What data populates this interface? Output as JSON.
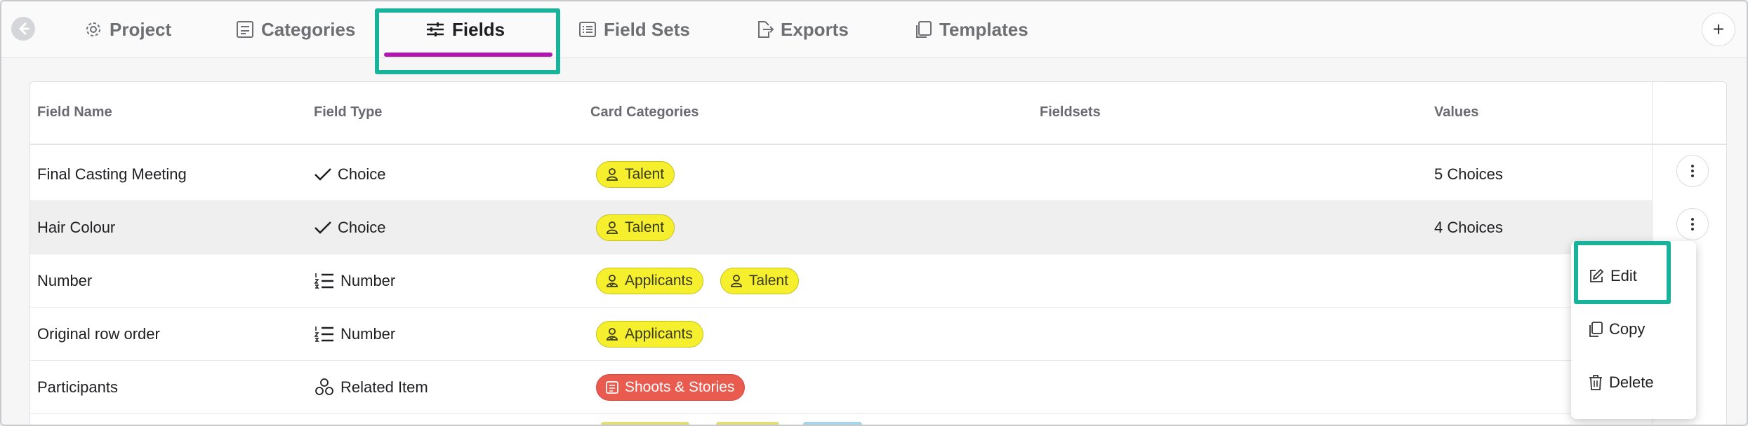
{
  "tabs": [
    {
      "label": "Project",
      "icon": "gear-icon"
    },
    {
      "label": "Categories",
      "icon": "categories-icon"
    },
    {
      "label": "Fields",
      "icon": "sliders-icon",
      "active": true
    },
    {
      "label": "Field Sets",
      "icon": "list-icon"
    },
    {
      "label": "Exports",
      "icon": "export-icon"
    },
    {
      "label": "Templates",
      "icon": "copy-icon"
    }
  ],
  "add_label": "+",
  "table": {
    "headers": [
      "Field Name",
      "Field Type",
      "Card Categories",
      "Fieldsets",
      "Values"
    ],
    "rows": [
      {
        "name": "Final Casting Meeting",
        "type": "Choice",
        "type_icon": "check-icon",
        "categories": [
          "Talent"
        ],
        "values": "5 Choices"
      },
      {
        "name": "Hair Colour",
        "type": "Choice",
        "type_icon": "check-icon",
        "categories": [
          "Talent"
        ],
        "values": "4 Choices",
        "hover": true
      },
      {
        "name": "Number",
        "type": "Number",
        "type_icon": "numbered-list-icon",
        "categories": [
          "Applicants",
          "Talent"
        ],
        "values": ""
      },
      {
        "name": "Original row order",
        "type": "Number",
        "type_icon": "numbered-list-icon",
        "categories": [
          "Applicants"
        ],
        "values": ""
      },
      {
        "name": "Participants",
        "type": "Related Item",
        "type_icon": "related-item-icon",
        "categories": [
          "Shoots & Stories"
        ],
        "values": ""
      }
    ]
  },
  "menu": {
    "edit": "Edit",
    "copy": "Copy",
    "delete": "Delete"
  },
  "colors": {
    "accent": "#b314b3",
    "highlight": "#18b39a",
    "tag_yellow": "#f6ef2e",
    "tag_red": "#e95a4f"
  }
}
